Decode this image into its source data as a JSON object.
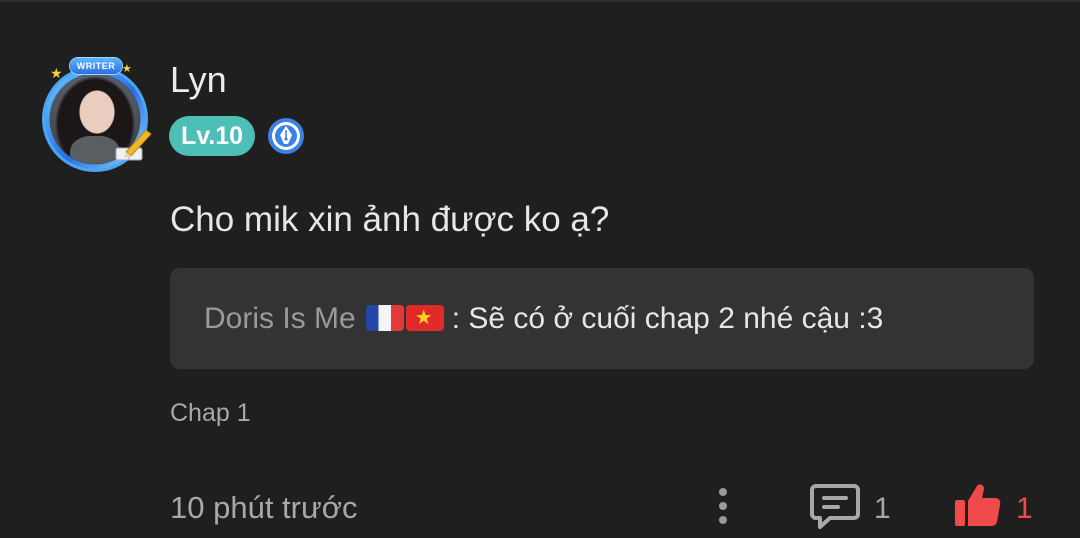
{
  "comment": {
    "avatar_badge_text": "WRITER",
    "username": "Lyn",
    "level_badge": "Lv.10",
    "text": "Cho mik xin ảnh được ko ạ?",
    "reply": {
      "author": "Doris Is Me",
      "separator": ":",
      "body": "Sẽ có ở cuối chap 2 nhé cậu :3",
      "flags": [
        "flag-france-icon",
        "flag-vietnam-icon"
      ]
    },
    "chapter": "Chap 1",
    "timestamp": "10 phút trước",
    "reply_count": "1",
    "like_count": "1"
  },
  "colors": {
    "background": "#1f1f1f",
    "reply_box": "#333333",
    "level_badge": "#4dbfb6",
    "like": "#f04a4a",
    "muted_text": "#a8a8a8"
  },
  "icons": {
    "more": "more-vertical-icon",
    "reply": "comment-bubble-icon",
    "like": "thumbs-up-icon",
    "writer_badge": "fountain-pen-badge-icon"
  }
}
